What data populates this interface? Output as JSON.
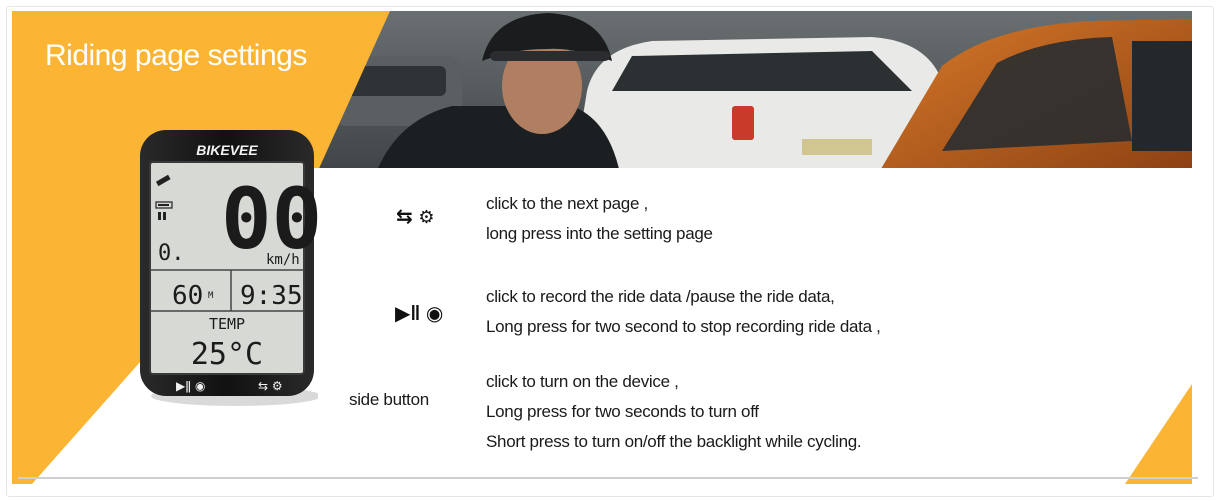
{
  "title": "Riding page settings",
  "device": {
    "brand": "BIKEVEE",
    "speed_value": "00",
    "speed_unit": "km/h",
    "small_value": "0.",
    "distance_value": "60",
    "distance_unit": "M",
    "time_value": "9:35",
    "temp_label": "TEMP",
    "temp_value": "25°C"
  },
  "instructions": [
    {
      "icon": "cycle-settings-icon",
      "lines": [
        "click to the next page ,",
        "long press into the setting page"
      ]
    },
    {
      "icon": "play-pause-record-icon",
      "lines": [
        "click to record the ride data /pause the ride data,",
        "Long press for two second to stop recording ride data ,"
      ]
    },
    {
      "label": "side button",
      "lines": [
        "click to turn on the device ,",
        "Long press for two seconds to turn off",
        "Short press to turn on/off the backlight while cycling."
      ]
    }
  ],
  "colors": {
    "accent": "#fbb433",
    "text": "#1a1a1a",
    "white": "#ffffff"
  }
}
